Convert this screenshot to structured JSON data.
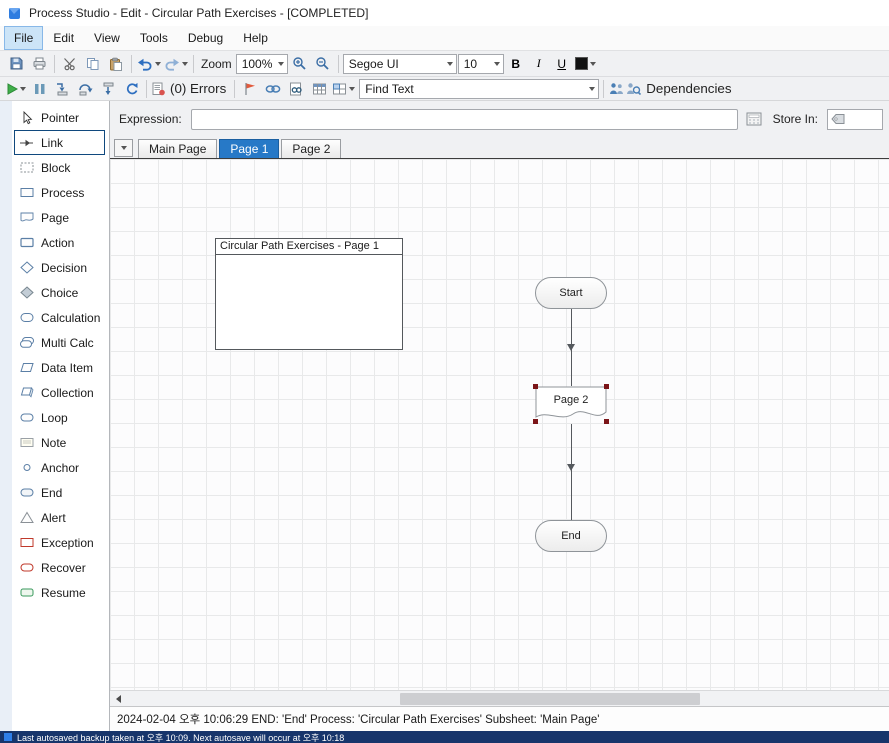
{
  "colors": {
    "active_tab_blue": "#2779c7",
    "selection_handle_red": "#7b1518",
    "accent_blue": "#4a7fb5",
    "exception_red": "#c0392b",
    "resume_green": "#3a9a5c"
  },
  "window": {
    "title": "Process Studio - Edit - Circular Path Exercises - [COMPLETED]"
  },
  "menu": {
    "items": [
      {
        "label": "File",
        "active": true
      },
      {
        "label": "Edit"
      },
      {
        "label": "View"
      },
      {
        "label": "Tools"
      },
      {
        "label": "Debug"
      },
      {
        "label": "Help"
      }
    ]
  },
  "toolbar_main": {
    "zoom_label": "Zoom",
    "zoom_value": "100%",
    "font_name": "Segoe UI",
    "font_size": "10",
    "bold_label": "B",
    "italic_label": "I",
    "underline_label": "U"
  },
  "toolbar_debug": {
    "errors_label": "(0) Errors",
    "find_text_value": "Find Text",
    "dependencies_label": "Dependencies"
  },
  "expression_bar": {
    "label": "Expression:",
    "value": "",
    "store_in_label": "Store In:",
    "store_in_value": ""
  },
  "tabs": {
    "items": [
      {
        "label": "Main Page"
      },
      {
        "label": "Page 1",
        "active": true
      },
      {
        "label": "Page 2"
      }
    ]
  },
  "palette": {
    "items": [
      {
        "label": "Pointer",
        "icon": "pointer-icon"
      },
      {
        "label": "Link",
        "icon": "link-icon",
        "selected": true
      },
      {
        "label": "Block",
        "icon": "block-icon"
      },
      {
        "label": "Process",
        "icon": "process-icon"
      },
      {
        "label": "Page",
        "icon": "page-icon"
      },
      {
        "label": "Action",
        "icon": "action-icon"
      },
      {
        "label": "Decision",
        "icon": "decision-icon"
      },
      {
        "label": "Choice",
        "icon": "choice-icon"
      },
      {
        "label": "Calculation",
        "icon": "calculation-icon"
      },
      {
        "label": "Multi Calc",
        "icon": "multi-calc-icon"
      },
      {
        "label": "Data Item",
        "icon": "data-item-icon"
      },
      {
        "label": "Collection",
        "icon": "collection-icon"
      },
      {
        "label": "Loop",
        "icon": "loop-icon"
      },
      {
        "label": "Note",
        "icon": "note-icon"
      },
      {
        "label": "Anchor",
        "icon": "anchor-icon"
      },
      {
        "label": "End",
        "icon": "end-icon"
      },
      {
        "label": "Alert",
        "icon": "alert-icon"
      },
      {
        "label": "Exception",
        "icon": "exception-icon"
      },
      {
        "label": "Recover",
        "icon": "recover-icon"
      },
      {
        "label": "Resume",
        "icon": "resume-icon"
      }
    ]
  },
  "canvas": {
    "note_title": "Circular Path Exercises - Page 1",
    "nodes": [
      {
        "label": "Start",
        "type": "stadium"
      },
      {
        "label": "Page 2",
        "type": "page-reference",
        "selected": true
      },
      {
        "label": "End",
        "type": "stadium"
      }
    ]
  },
  "status_bar": {
    "text": "2024-02-04 오후 10:06:29 END: 'End' Process: 'Circular Path Exercises' Subsheet: 'Main Page'"
  },
  "taskbar": {
    "text": "Last autosaved backup taken at 오후 10:09. Next autosave will occur at 오후 10:18"
  }
}
